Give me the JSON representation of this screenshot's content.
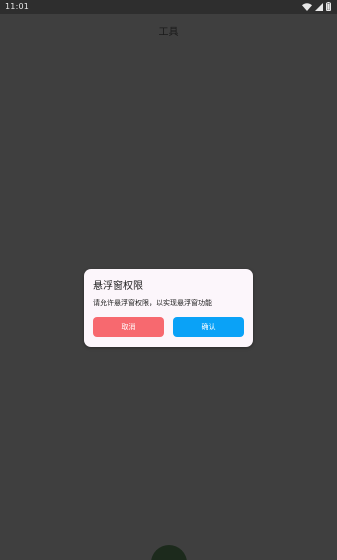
{
  "status_bar": {
    "time": "11:01",
    "icons": [
      "wifi-icon",
      "signal-icon",
      "battery-icon"
    ]
  },
  "page": {
    "title": "工具"
  },
  "dialog": {
    "title": "悬浮窗权限",
    "message": "请允许悬浮窗权限，以实现悬浮窗功能",
    "cancel_label": "取消",
    "confirm_label": "确认"
  },
  "colors": {
    "background": "#3f3f3f",
    "dialog_background": "#fcf6fb",
    "cancel_button": "#f7696f",
    "confirm_button": "#0aa2f7"
  }
}
